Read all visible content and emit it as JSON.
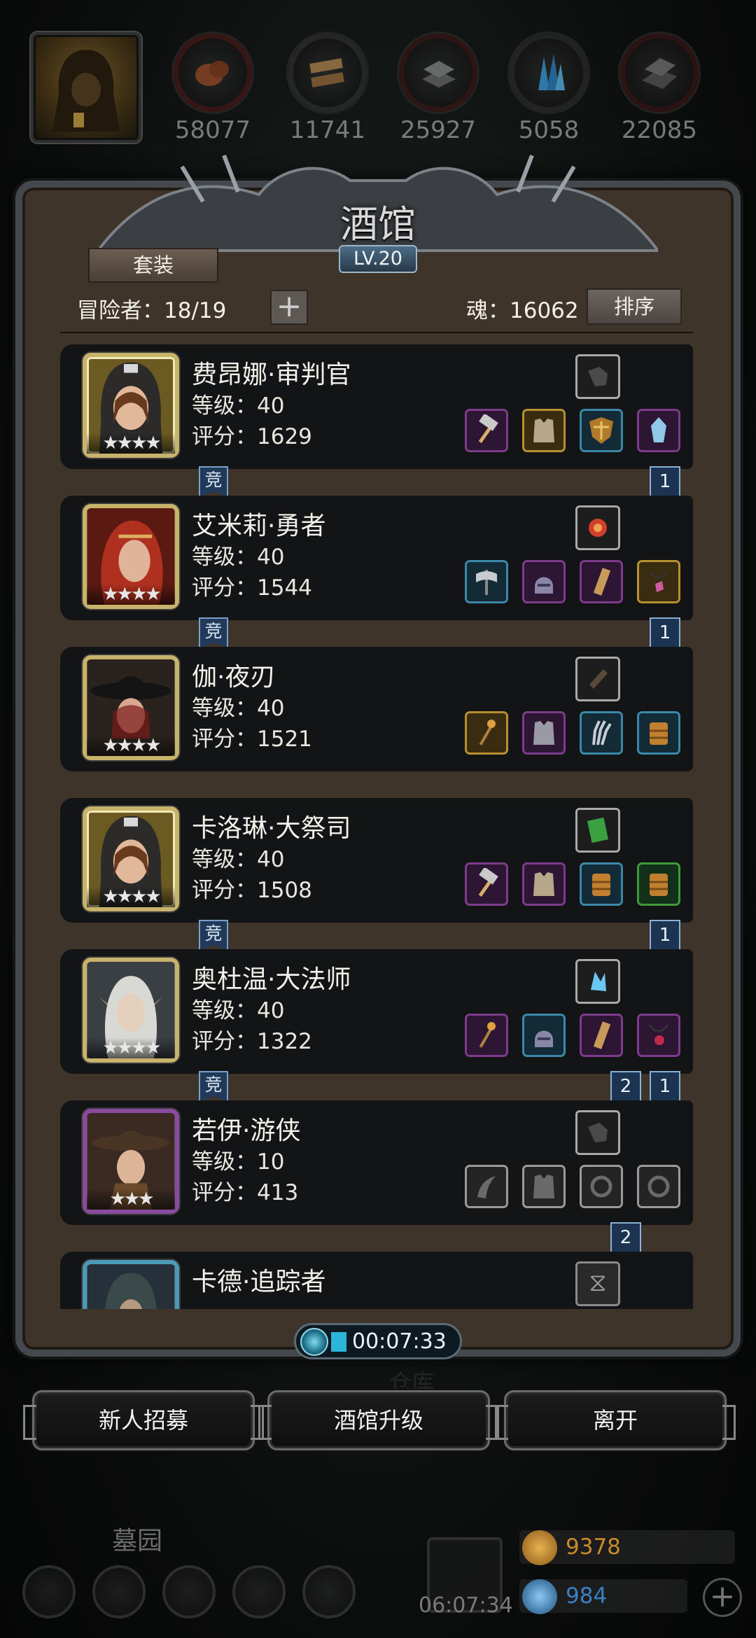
{
  "resources": [
    {
      "icon": "meat-icon",
      "value": "58077"
    },
    {
      "icon": "wood-planks-icon",
      "value": "11741"
    },
    {
      "icon": "iron-ingot-icon",
      "value": "25927"
    },
    {
      "icon": "crystal-icon",
      "value": "5058"
    },
    {
      "icon": "stone-icon",
      "value": "22085"
    }
  ],
  "tavern": {
    "title": "酒馆",
    "level": "LV.20",
    "suit_label": "套装",
    "adventurers_label": "冒险者：18/19",
    "soul_label": "魂：16062",
    "sort_label": "排序"
  },
  "heroes": [
    {
      "name": "费昂娜·审判官",
      "level": "等级：40",
      "score": "评分：1629",
      "stars": "★★★★",
      "frame": "gold",
      "jing": "竞",
      "ribbons": [
        "1"
      ]
    },
    {
      "name": "艾米莉·勇者",
      "level": "等级：40",
      "score": "评分：1544",
      "stars": "★★★★",
      "frame": "gold",
      "jing": "竞",
      "ribbons": [
        "1"
      ]
    },
    {
      "name": "伽·夜刃",
      "level": "等级：40",
      "score": "评分：1521",
      "stars": "★★★★",
      "frame": "gold",
      "jing": "",
      "ribbons": []
    },
    {
      "name": "卡洛琳·大祭司",
      "level": "等级：40",
      "score": "评分：1508",
      "stars": "★★★★",
      "frame": "gold",
      "jing": "竞",
      "ribbons": [
        "1"
      ]
    },
    {
      "name": "奥杜温·大法师",
      "level": "等级：40",
      "score": "评分：1322",
      "stars": "★★★★",
      "frame": "gold",
      "jing": "竞",
      "ribbons": [
        "2",
        "1"
      ]
    },
    {
      "name": "若伊·游侠",
      "level": "等级：10",
      "score": "评分：413",
      "stars": "★★★",
      "frame": "purple",
      "jing": "",
      "ribbons": [
        "2"
      ]
    },
    {
      "name": "卡德·追踪者",
      "level": "",
      "score": "",
      "stars": "",
      "frame": "blue",
      "jing": "",
      "ribbons": []
    }
  ],
  "timer": "00:07:33",
  "buttons": {
    "recruit": "新人招募",
    "upgrade": "酒馆升级",
    "leave": "离开"
  },
  "background": {
    "warehouse": "仓库",
    "cemetery": "墓园",
    "clock": "06:07:34"
  },
  "currency": {
    "gold": "9378",
    "gems": "984",
    "gold_color": "#c98a2a",
    "gem_color": "#3b7fc4"
  }
}
